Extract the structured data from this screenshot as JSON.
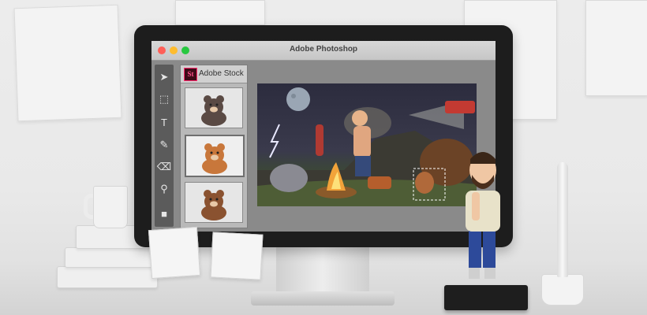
{
  "window": {
    "title": "Adobe Photoshop",
    "controls": {
      "close_color": "#ff5f57",
      "minimize_color": "#febc2e",
      "zoom_color": "#28c840"
    }
  },
  "tools": [
    {
      "name": "select-arrow-icon",
      "glyph": "➤"
    },
    {
      "name": "marquee-icon",
      "glyph": "⬚"
    },
    {
      "name": "text-tool-icon",
      "glyph": "T"
    },
    {
      "name": "brush-icon",
      "glyph": "✎"
    },
    {
      "name": "eraser-icon",
      "glyph": "⌫"
    },
    {
      "name": "zoom-icon",
      "glyph": "⚲"
    },
    {
      "name": "color-swatch-icon",
      "glyph": "■"
    }
  ],
  "stock_panel": {
    "logo": "St",
    "label": "Adobe Stock",
    "accent": "#ff2a6d",
    "thumbnails": [
      {
        "name": "dark-bear-thumbnail",
        "color": "#5a4a44",
        "selected": false
      },
      {
        "name": "orange-bear-thumbnail",
        "color": "#c8773b",
        "selected": true
      },
      {
        "name": "brown-bear-thumbnail",
        "color": "#8a5230",
        "selected": false
      }
    ]
  }
}
